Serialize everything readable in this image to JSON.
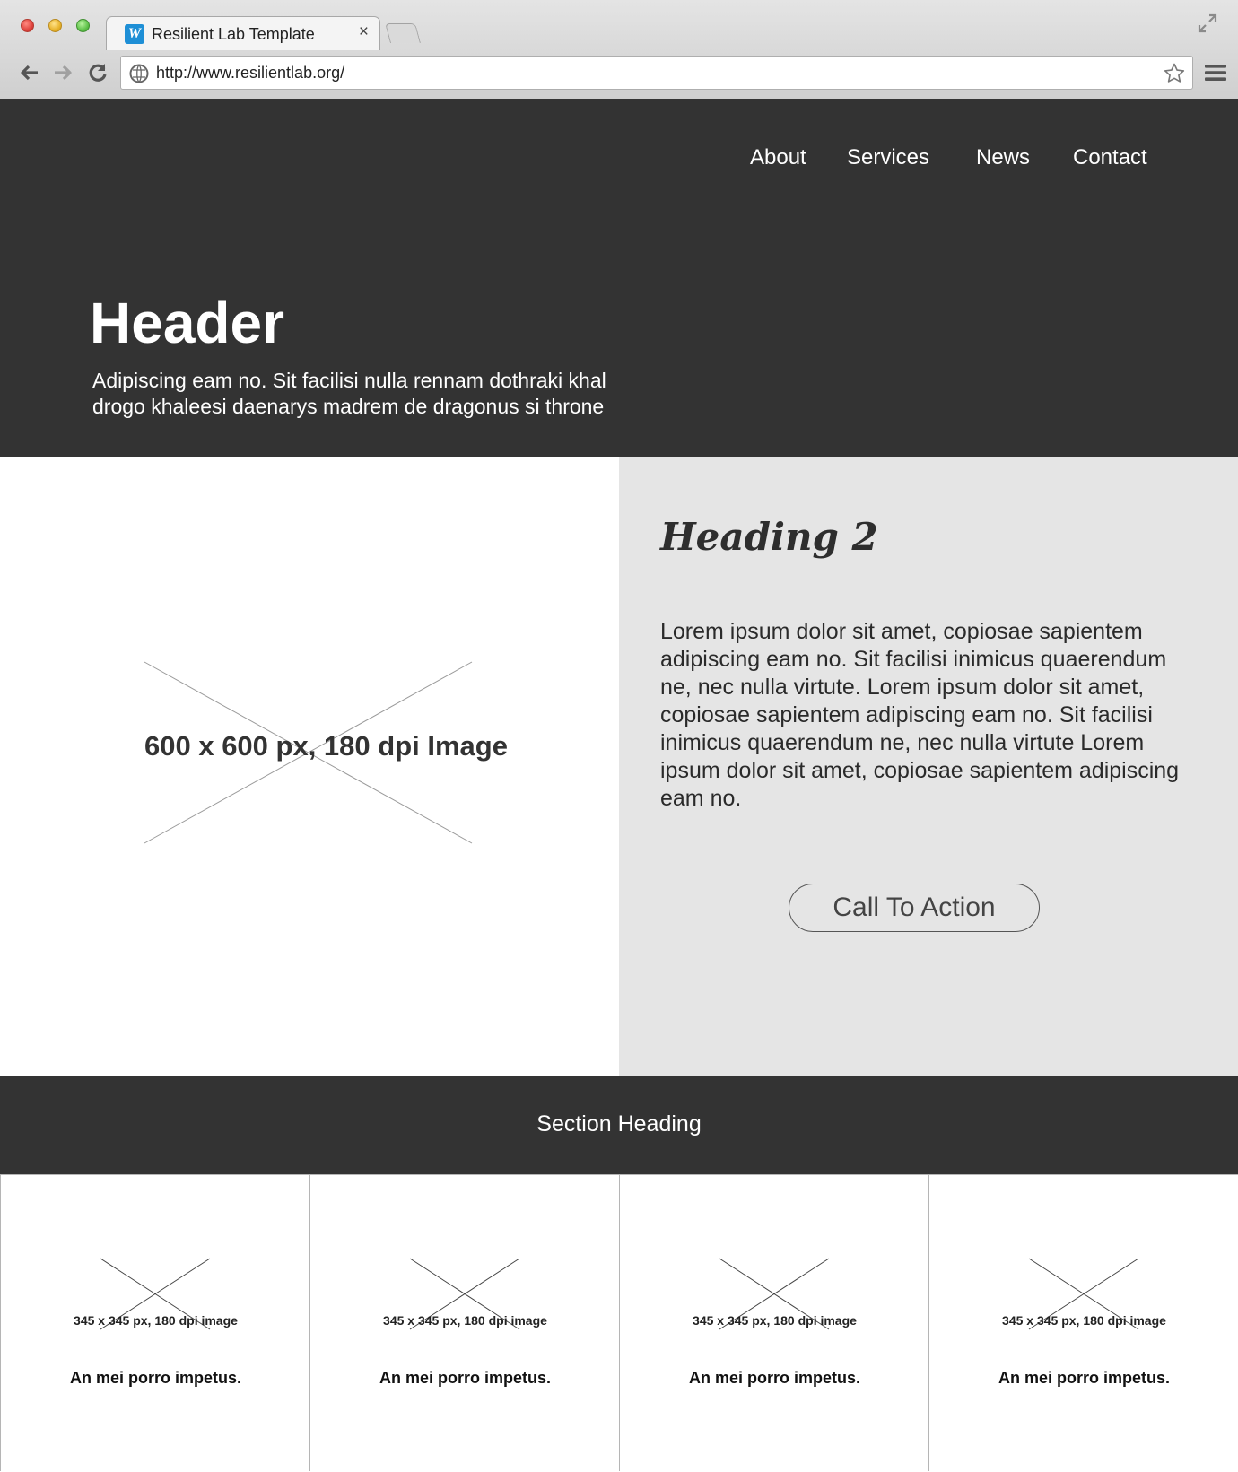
{
  "browser": {
    "tab_title": "Resilient Lab Template",
    "tab_favicon_letter": "W",
    "tab_close": "×",
    "url": "http://www.resilientlab.org/"
  },
  "nav": {
    "items": [
      "About",
      "Services",
      "News",
      "Contact"
    ]
  },
  "hero": {
    "title": "Header",
    "subtitle": "Adipiscing eam no. Sit facilisi nulla rennam dothraki khal drogo khaleesi daenarys madrem de dragonus si throne"
  },
  "feature": {
    "image_label": "600 x 600 px, 180 dpi Image",
    "heading": "Heading 2",
    "body": "Lorem ipsum dolor sit amet, copiosae sapientem adipiscing eam no. Sit facilisi inimicus quaerendum ne, nec nulla virtute. Lorem ipsum dolor sit amet, copiosae sapientem adipiscing eam no. Sit facilisi inimicus quaerendum ne, nec nulla virtute Lorem ipsum dolor sit amet, copiosae sapientem adipiscing eam no.",
    "cta_label": "Call To Action"
  },
  "section": {
    "heading": "Section Heading"
  },
  "cards": [
    {
      "image_label": "345 x 345 px, 180 dpi image",
      "caption": "An mei porro impetus."
    },
    {
      "image_label": "345 x 345 px, 180 dpi image",
      "caption": "An mei porro impetus."
    },
    {
      "image_label": "345 x 345 px, 180 dpi image",
      "caption": "An mei porro impetus."
    },
    {
      "image_label": "345 x 345 px, 180 dpi image",
      "caption": "An mei porro impetus."
    }
  ],
  "colors": {
    "dark_band": "#333333",
    "light_panel": "#e5e5e5",
    "favicon": "#1e8fd6"
  },
  "icons": [
    "back-arrow-icon",
    "forward-arrow-icon",
    "reload-icon",
    "globe-icon",
    "star-icon",
    "hamburger-menu-icon",
    "fullscreen-icon"
  ]
}
